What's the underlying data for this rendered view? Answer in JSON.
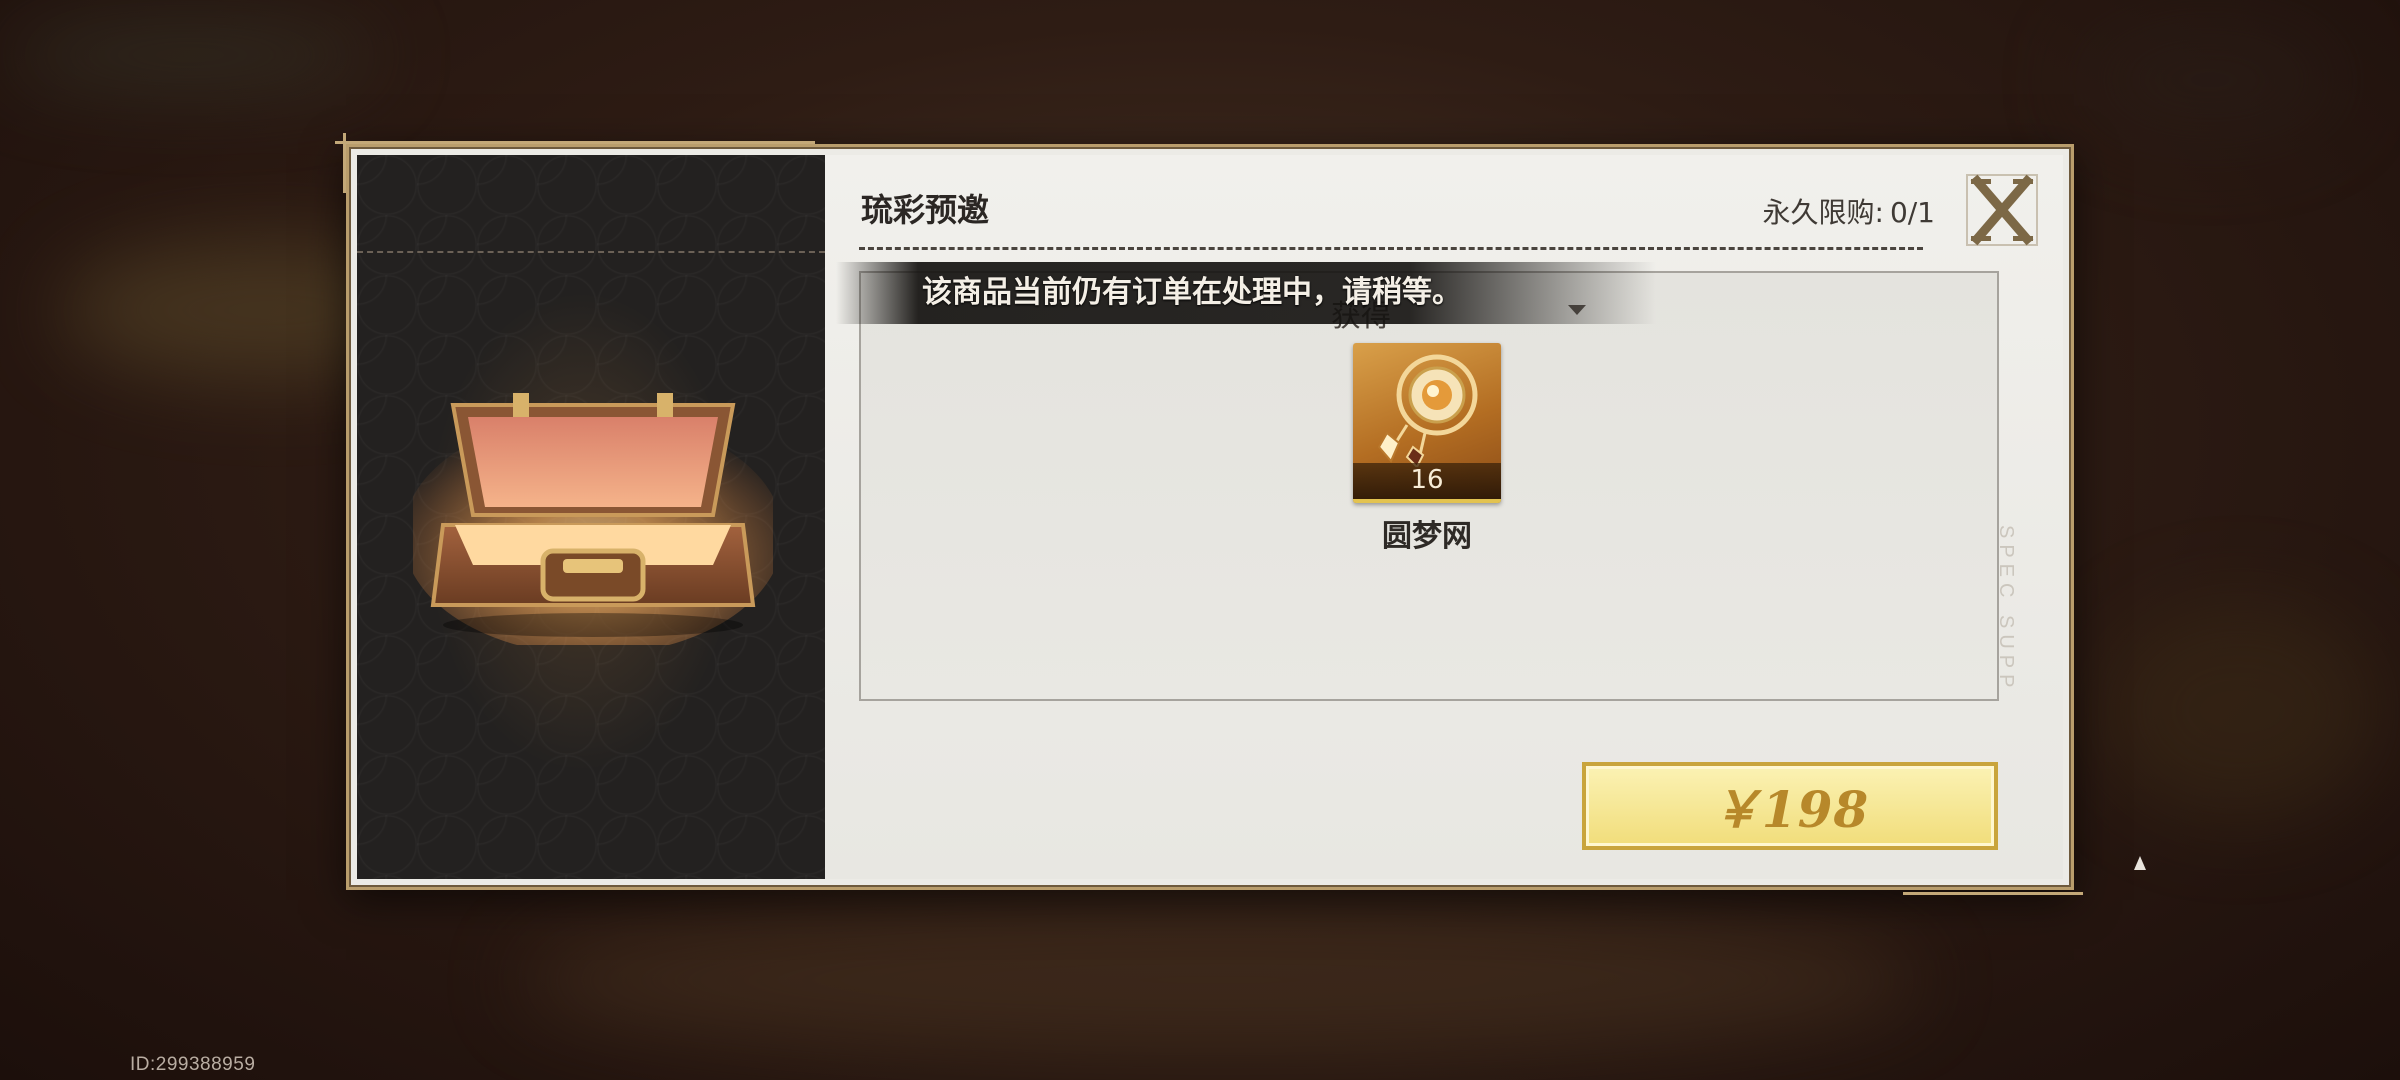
{
  "dialog": {
    "title": "琉彩预邀",
    "limit_label": "永久限购:",
    "limit_value": "0/1",
    "close_label": "X"
  },
  "toast": {
    "message": "该商品当前仍有订单在处理中，请稍等。"
  },
  "rewards": {
    "header": "获得",
    "items": [
      {
        "name": "圆梦网",
        "count": "16",
        "icon": "dreamcatcher-icon"
      }
    ]
  },
  "purchase": {
    "price_label": "￥198"
  },
  "footer": {
    "id_text": "ID:299388959"
  },
  "colors": {
    "accent_gold": "#c9a43c",
    "frame_gold": "#b99d6c",
    "price_text": "#b7882a"
  }
}
